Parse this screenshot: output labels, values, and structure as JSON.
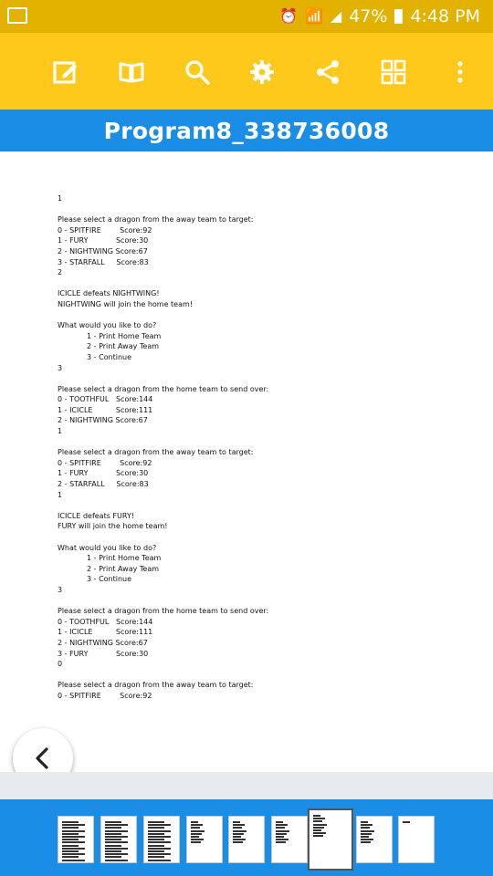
{
  "status_bar": {
    "battery_percent": "47%",
    "time": "4:48 PM",
    "icons": [
      "image-icon",
      "alarm-icon",
      "wifi-icon",
      "signal-icon",
      "battery-icon"
    ]
  },
  "toolbar": {
    "icons": [
      "edit-icon",
      "book-icon",
      "search-icon",
      "settings-gear-icon",
      "share-icon",
      "grid-view-icon",
      "more-vertical-icon"
    ]
  },
  "document": {
    "title": "Program8_338736008",
    "lines": [
      {
        "text": "1",
        "indent": 0
      },
      {
        "text": "",
        "indent": 0
      },
      {
        "text": "Please select a dragon from the away team to target:",
        "indent": 0
      },
      {
        "text": "0 - SPITFIRE        Score:92",
        "indent": 0
      },
      {
        "text": "1 - FURY            Score:30",
        "indent": 0
      },
      {
        "text": "2 - NIGHTWING Score:67",
        "indent": 0
      },
      {
        "text": "3 - STARFALL     Score:83",
        "indent": 0
      },
      {
        "text": "2",
        "indent": 0
      },
      {
        "text": "",
        "indent": 0
      },
      {
        "text": "ICICLE defeats NIGHTWING!",
        "indent": 0
      },
      {
        "text": "NIGHTWING will join the home team!",
        "indent": 0
      },
      {
        "text": "",
        "indent": 0
      },
      {
        "text": "What would you like to do?",
        "indent": 0
      },
      {
        "text": "1 - Print Home Team",
        "indent": 1
      },
      {
        "text": "2 - Print Away Team",
        "indent": 1
      },
      {
        "text": "3 - Continue",
        "indent": 1
      },
      {
        "text": "3",
        "indent": 0
      },
      {
        "text": "",
        "indent": 0
      },
      {
        "text": "Please select a dragon from the home team to send over:",
        "indent": 0
      },
      {
        "text": "0 - TOOTHFUL   Score:144",
        "indent": 0
      },
      {
        "text": "1 - ICICLE          Score:111",
        "indent": 0
      },
      {
        "text": "2 - NIGHTWING Score:67",
        "indent": 0
      },
      {
        "text": "1",
        "indent": 0
      },
      {
        "text": "",
        "indent": 0
      },
      {
        "text": "Please select a dragon from the away team to target:",
        "indent": 0
      },
      {
        "text": "0 - SPITFIRE        Score:92",
        "indent": 0
      },
      {
        "text": "1 - FURY            Score:30",
        "indent": 0
      },
      {
        "text": "2 - STARFALL     Score:83",
        "indent": 0
      },
      {
        "text": "1",
        "indent": 0
      },
      {
        "text": "",
        "indent": 0
      },
      {
        "text": "ICICLE defeats FURY!",
        "indent": 0
      },
      {
        "text": "FURY will join the home team!",
        "indent": 0
      },
      {
        "text": "",
        "indent": 0
      },
      {
        "text": "What would you like to do?",
        "indent": 0
      },
      {
        "text": "1 - Print Home Team",
        "indent": 1
      },
      {
        "text": "2 - Print Away Team",
        "indent": 1
      },
      {
        "text": "3 - Continue",
        "indent": 1
      },
      {
        "text": "3",
        "indent": 0
      },
      {
        "text": "",
        "indent": 0
      },
      {
        "text": "Please select a dragon from the home team to send over:",
        "indent": 0
      },
      {
        "text": "0 - TOOTHFUL   Score:144",
        "indent": 0
      },
      {
        "text": "1 - ICICLE          Score:111",
        "indent": 0
      },
      {
        "text": "2 - NIGHTWING Score:67",
        "indent": 0
      },
      {
        "text": "3 - FURY            Score:30",
        "indent": 0
      },
      {
        "text": "0",
        "indent": 0
      },
      {
        "text": "",
        "indent": 0
      },
      {
        "text": "Please select a dragon from the away team to target:",
        "indent": 0
      },
      {
        "text": "0 - SPITFIRE        Score:92",
        "indent": 0
      }
    ]
  },
  "navigation": {
    "back_icon": "chevron-left-icon"
  },
  "page_thumbnails": {
    "count": 9,
    "active_index": 6
  },
  "colors": {
    "status_bar": "#e3b100",
    "toolbar": "#ffc91c",
    "title_bar": "#1a8ee6",
    "thumb_strip": "#1a8ee6"
  }
}
